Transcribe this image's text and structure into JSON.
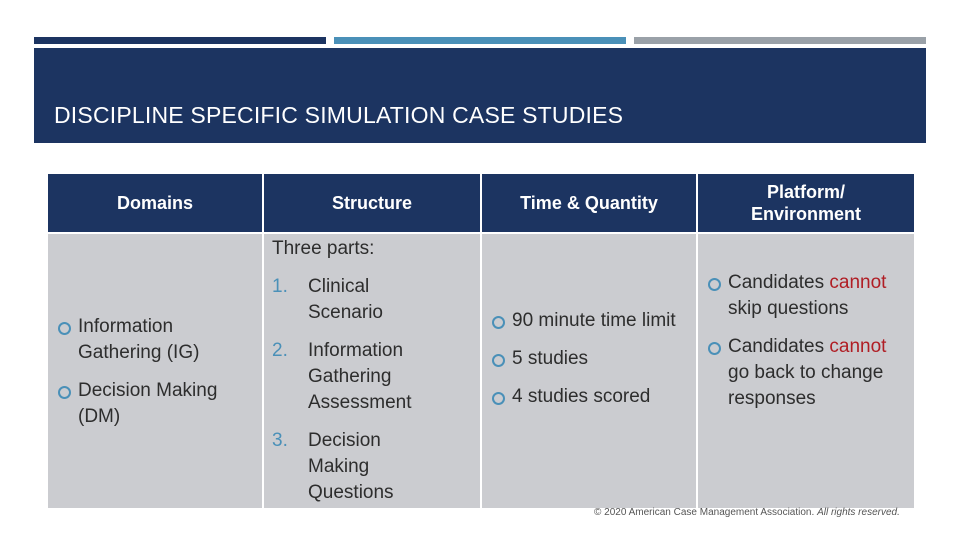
{
  "slide": {
    "title": "DISCIPLINE SPECIFIC SIMULATION CASE STUDIES",
    "colors": {
      "navy": "#1c3461",
      "blue": "#4a90b8",
      "gray": "#9aa1a8",
      "cell": "#cbccd0",
      "emphasis": "#b01d24"
    }
  },
  "table": {
    "headers": [
      "Domains",
      "Structure",
      "Time & Quantity",
      "Platform/ Environment"
    ],
    "domains": [
      "Information Gathering (IG)",
      "Decision Making (DM)"
    ],
    "structure": {
      "intro": "Three parts:",
      "items": [
        {
          "n": "1.",
          "text": "Clinical Scenario"
        },
        {
          "n": "2.",
          "text": "Information Gathering Assessment"
        },
        {
          "n": "3.",
          "text": "Decision Making Questions"
        }
      ]
    },
    "time_quantity": [
      "90 minute time limit",
      "5 studies",
      "4 studies scored"
    ],
    "platform": [
      {
        "lead": "Candidates",
        "emphasis": "cannot",
        "rest": "skip questions"
      },
      {
        "lead": "Candidates",
        "emphasis": "cannot",
        "rest": "go back to change responses"
      }
    ]
  },
  "footer": {
    "copyright": "© 2020 American Case Management Association.",
    "rights": "All rights reserved."
  }
}
